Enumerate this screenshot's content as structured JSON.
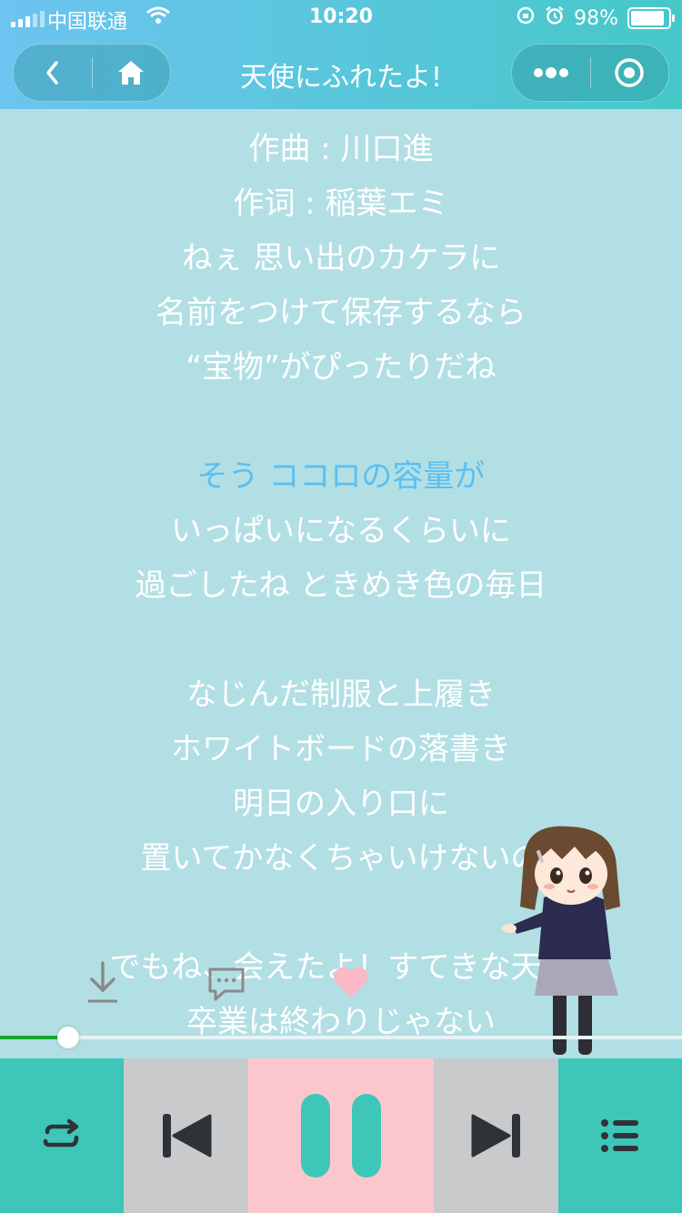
{
  "status": {
    "carrier": "中国联通",
    "time": "10:20",
    "battery": "98%",
    "battery_level": 0.98
  },
  "nav": {
    "title": "天使にふれたよ!"
  },
  "lyrics": [
    {
      "text": "作曲 : 川口進",
      "active": false
    },
    {
      "text": "作词 : 稲葉エミ",
      "active": false
    },
    {
      "text": "ねぇ 思い出のカケラに",
      "active": false
    },
    {
      "text": "名前をつけて保存するなら",
      "active": false
    },
    {
      "text": "“宝物”がぴったりだね",
      "active": false
    },
    {
      "text": "",
      "active": false
    },
    {
      "text": "そう ココロの容量が",
      "active": true
    },
    {
      "text": "いっぱいになるくらいに",
      "active": false
    },
    {
      "text": "過ごしたね ときめき色の毎日",
      "active": false
    },
    {
      "text": "",
      "active": false
    },
    {
      "text": "なじんだ制服と上履き",
      "active": false
    },
    {
      "text": "ホワイトボードの落書き",
      "active": false
    },
    {
      "text": "明日の入り口に",
      "active": false
    },
    {
      "text": "置いてかなくちゃいけないの",
      "active": false
    },
    {
      "text": "",
      "active": false
    },
    {
      "text": "でもね、会えたよ！すてきな天使",
      "active": false
    },
    {
      "text": "卒業は終わりじゃない",
      "active": false
    }
  ],
  "player": {
    "progress": 0.1
  },
  "colors": {
    "accent_teal": "#3ec6b8",
    "pink": "#fbc7cd",
    "gray": "#c9cacb",
    "active_lyric": "#5bbff0",
    "progress_played": "#1aa52b"
  },
  "icons": [
    "back-icon",
    "home-icon",
    "more-icon",
    "close-mini-program-icon",
    "download-icon",
    "comment-icon",
    "heart-icon",
    "repeat-icon",
    "previous-icon",
    "pause-icon",
    "next-icon",
    "playlist-icon"
  ]
}
